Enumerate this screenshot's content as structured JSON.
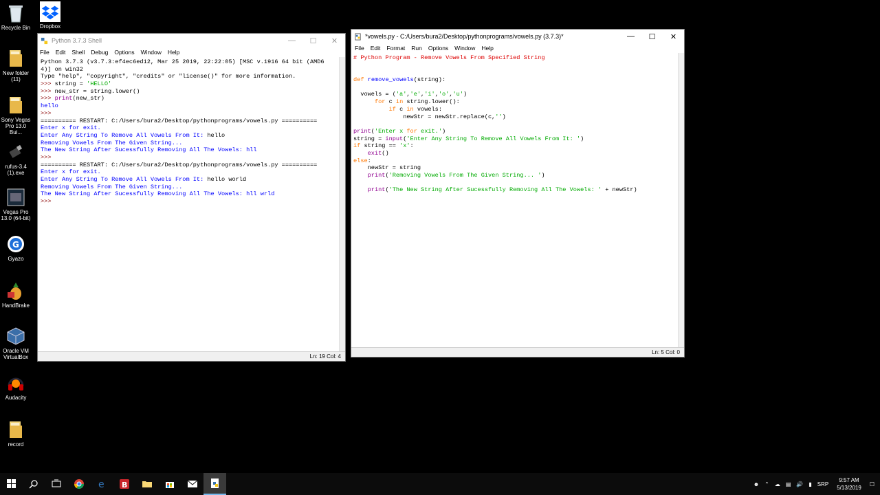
{
  "desktop_icons": [
    {
      "label": "Recycle Bin",
      "icon": "recycle-bin-icon"
    },
    {
      "label": "New folder\n(11)",
      "icon": "folder-icon"
    },
    {
      "label": "Sony Vegas\nPro 13.0 Bui...",
      "icon": "folder-icon"
    },
    {
      "label": "rufus-3.4\n(1).exe",
      "icon": "usb-drive-icon"
    },
    {
      "label": "Vegas Pro\n13.0 (64-bit)",
      "icon": "film-icon"
    },
    {
      "label": "Gyazo",
      "icon": "gyazo-icon"
    },
    {
      "label": "HandBrake",
      "icon": "pineapple-icon"
    },
    {
      "label": "Oracle VM\nVirtualBox",
      "icon": "cube-icon"
    },
    {
      "label": "Audacity",
      "icon": "headphones-icon"
    },
    {
      "label": "record",
      "icon": "folder-icon"
    }
  ],
  "desktop_icons_col2": [
    {
      "label": "Dropbox",
      "icon": "dropbox-icon"
    }
  ],
  "shell": {
    "title": "Python 3.7.3 Shell",
    "menu": [
      "File",
      "Edit",
      "Shell",
      "Debug",
      "Options",
      "Window",
      "Help"
    ],
    "lines": [
      "Python 3.7.3 (v3.7.3:ef4ec6ed12, Mar 25 2019, 22:22:05) [MSC v.1916 64 bit (AMD6",
      "4)] on win32",
      "Type \"help\", \"copyright\", \"credits\" or \"license()\" for more information.",
      ">>> string = 'HELLO'",
      ">>> new_str = string.lower()",
      ">>> print(new_str)",
      "hello",
      ">>>",
      "========== RESTART: C:/Users/bura2/Desktop/pythonprograms/vowels.py ==========",
      "Enter x for exit.",
      "Enter Any String To Remove All Vowels From It: hello",
      "Removing Vowels From The Given String...",
      "The New String After Sucessfully Removing All The Vowels: hll",
      ">>>",
      "========== RESTART: C:/Users/bura2/Desktop/pythonprograms/vowels.py ==========",
      "Enter x for exit.",
      "Enter Any String To Remove All Vowels From It: hello world",
      "Removing Vowels From The Given String...",
      "The New String After Sucessfully Removing All The Vowels: hll wrld",
      ">>>"
    ],
    "status": "Ln: 19   Col: 4"
  },
  "editor": {
    "title": "*vowels.py - C:/Users/bura2/Desktop/pythonprograms/vowels.py (3.7.3)*",
    "menu": [
      "File",
      "Edit",
      "Format",
      "Run",
      "Options",
      "Window",
      "Help"
    ],
    "lines": [
      "# Python Program - Remove Vowels From Specified String",
      "",
      "",
      "def remove_vowels(string):",
      "",
      "  vowels = ('a','e','i','o','u')",
      "      for c in string.lower():",
      "          if c in vowels:",
      "              newStr = newStr.replace(c,'')",
      "",
      "print('Enter x for exit.')",
      "string = input('Enter Any String To Remove All Vowels From It: ')",
      "if string == 'x':",
      "    exit()",
      "else:",
      "    newStr = string",
      "    print('Removing Vowels From The Given String... ')",
      "",
      "    print('The New String After Sucessfully Removing All The Vowels: ' + newStr)"
    ],
    "status": "Ln: 5   Col: 0"
  },
  "taskbar": {
    "buttons": [
      "windows-start-icon",
      "search-icon",
      "task-view-icon",
      "chrome-icon",
      "edge-icon",
      "b-app-icon",
      "file-explorer-icon",
      "store-icon",
      "mail-icon",
      "idle-icon"
    ],
    "lang": "SRP",
    "time": "9:57 AM",
    "date": "5/13/2019"
  }
}
